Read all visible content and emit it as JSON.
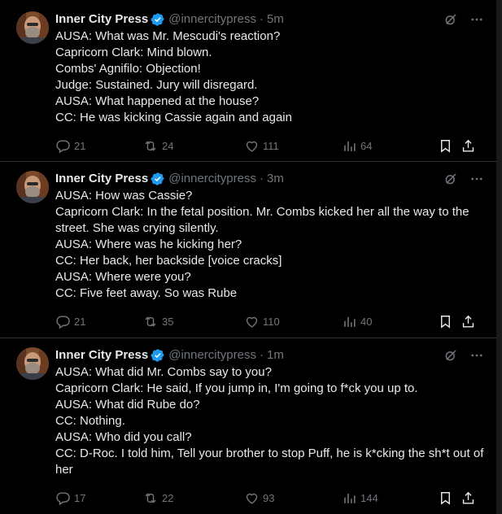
{
  "tweets": [
    {
      "name": "Inner City Press",
      "handle": "@innercitypress",
      "separator": "·",
      "time": "5m",
      "lines": [
        "AUSA: What was Mr. Mescudi's reaction?",
        "Capricorn Clark: Mind blown.",
        "Combs' Agnifilo: Objection!",
        "Judge: Sustained. Jury will disregard.",
        "AUSA: What happened at the house?",
        "CC: He was kicking Cassie again and again"
      ],
      "replies": "21",
      "reposts": "24",
      "likes": "111",
      "views": "64"
    },
    {
      "name": "Inner City Press",
      "handle": "@innercitypress",
      "separator": "·",
      "time": "3m",
      "lines": [
        "AUSA: How was Cassie?",
        "Capricorn Clark: In the fetal position. Mr. Combs kicked her all the way to the street. She was crying silently.",
        "AUSA: Where was he kicking her?",
        "CC: Her back, her backside [voice cracks]",
        "AUSA: Where were you?",
        "CC: Five feet away. So was Rube"
      ],
      "replies": "21",
      "reposts": "35",
      "likes": "110",
      "views": "40"
    },
    {
      "name": "Inner City Press",
      "handle": "@innercitypress",
      "separator": "·",
      "time": "1m",
      "lines": [
        "AUSA: What did Mr. Combs say to you?",
        "Capricorn Clark: He said, If you jump in, I'm going to f*ck you up to.",
        "AUSA: What did Rube do?",
        "CC: Nothing.",
        "AUSA: Who did you call?",
        "CC: D-Roc. I told him, Tell your brother to stop Puff, he is k*cking the sh*t out of her"
      ],
      "replies": "17",
      "reposts": "22",
      "likes": "93",
      "views": "144"
    }
  ],
  "icons": {
    "verified": "verified-badge-icon",
    "grok": "grok-icon",
    "more": "more-icon",
    "reply": "reply-icon",
    "retweet": "retweet-icon",
    "like": "like-icon",
    "views": "views-icon",
    "bookmark": "bookmark-icon",
    "share": "share-icon"
  },
  "colors": {
    "background": "#000000",
    "text": "#e7e9ea",
    "muted": "#71767b",
    "verified": "#1d9bf0",
    "divider": "#2f3336"
  }
}
